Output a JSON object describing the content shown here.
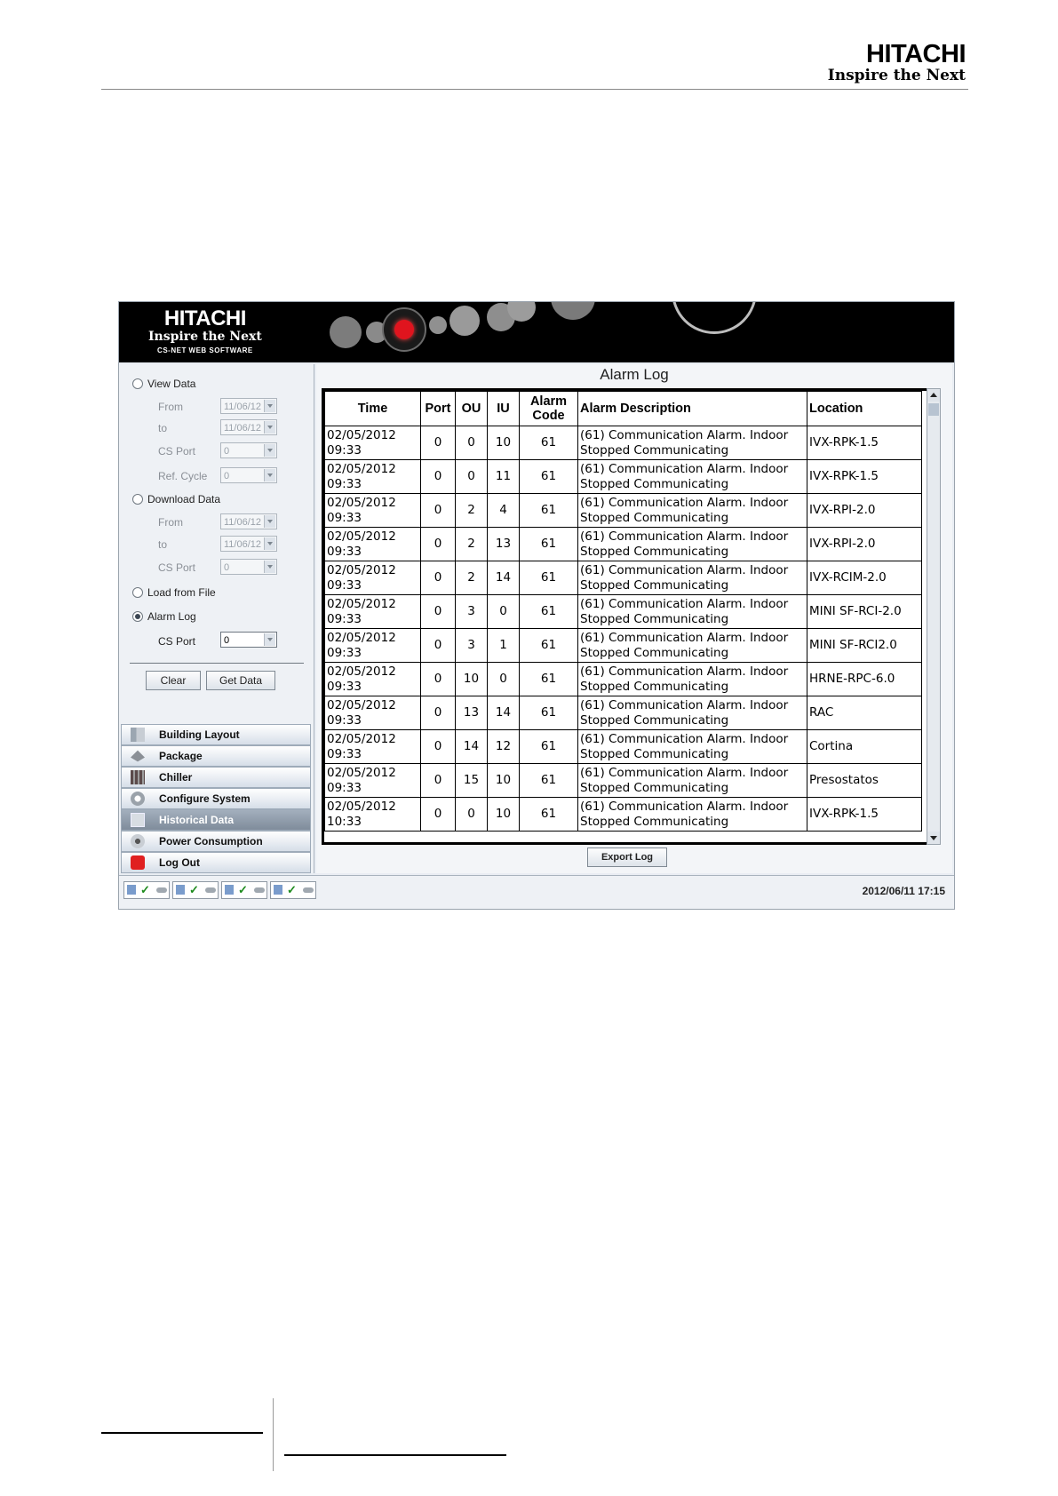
{
  "page_header": {
    "brand": "HITACHI",
    "tagline": "Inspire the Next"
  },
  "app": {
    "banner": {
      "brand": "HITACHI",
      "tagline": "Inspire the Next",
      "subtitle": "CS-NET WEB SOFTWARE"
    },
    "left": {
      "view_data": {
        "label": "View Data",
        "from_label": "From",
        "from_value": "11/06/12",
        "to_label": "to",
        "to_value": "11/06/12",
        "cs_port_label": "CS Port",
        "cs_port_value": "0",
        "ref_cycle_label": "Ref. Cycle",
        "ref_cycle_value": "0"
      },
      "download_data": {
        "label": "Download Data",
        "from_label": "From",
        "from_value": "11/06/12",
        "to_label": "to",
        "to_value": "11/06/12",
        "cs_port_label": "CS Port",
        "cs_port_value": "0"
      },
      "load_from_file": {
        "label": "Load from File"
      },
      "alarm_log": {
        "label": "Alarm Log",
        "cs_port_label": "CS Port",
        "cs_port_value": "0"
      },
      "clear_label": "Clear",
      "get_data_label": "Get Data",
      "nav": [
        {
          "label": "Building Layout",
          "icon": "building-icon"
        },
        {
          "label": "Package",
          "icon": "package-icon"
        },
        {
          "label": "Chiller",
          "icon": "chiller-icon"
        },
        {
          "label": "Configure System",
          "icon": "gear-icon"
        },
        {
          "label": "Historical Data",
          "icon": "historical-data-icon"
        },
        {
          "label": "Power Consumption",
          "icon": "power-consumption-icon"
        },
        {
          "label": "Log Out",
          "icon": "power-icon"
        }
      ]
    },
    "main": {
      "title": "Alarm Log",
      "columns": [
        "Time",
        "Port",
        "OU",
        "IU",
        "Alarm Code",
        "Alarm Description",
        "Location"
      ],
      "rows": [
        {
          "date": "02/05/2012",
          "time": "09:33",
          "port": "0",
          "ou": "0",
          "iu": "10",
          "code": "61",
          "desc1": "(61) Communication Alarm. Indoor",
          "desc2": "Stopped Communicating",
          "location": "IVX-RPK-1.5"
        },
        {
          "date": "02/05/2012",
          "time": "09:33",
          "port": "0",
          "ou": "0",
          "iu": "11",
          "code": "61",
          "desc1": "(61) Communication Alarm. Indoor",
          "desc2": "Stopped Communicating",
          "location": "IVX-RPK-1.5"
        },
        {
          "date": "02/05/2012",
          "time": "09:33",
          "port": "0",
          "ou": "2",
          "iu": "4",
          "code": "61",
          "desc1": "(61) Communication Alarm. Indoor",
          "desc2": "Stopped Communicating",
          "location": "IVX-RPI-2.0"
        },
        {
          "date": "02/05/2012",
          "time": "09:33",
          "port": "0",
          "ou": "2",
          "iu": "13",
          "code": "61",
          "desc1": "(61) Communication Alarm. Indoor",
          "desc2": "Stopped Communicating",
          "location": "IVX-RPI-2.0"
        },
        {
          "date": "02/05/2012",
          "time": "09:33",
          "port": "0",
          "ou": "2",
          "iu": "14",
          "code": "61",
          "desc1": "(61) Communication Alarm. Indoor",
          "desc2": "Stopped Communicating",
          "location": "IVX-RCIM-2.0"
        },
        {
          "date": "02/05/2012",
          "time": "09:33",
          "port": "0",
          "ou": "3",
          "iu": "0",
          "code": "61",
          "desc1": "(61) Communication Alarm. Indoor",
          "desc2": "Stopped Communicating",
          "location": "MINI SF-RCI-2.0"
        },
        {
          "date": "02/05/2012",
          "time": "09:33",
          "port": "0",
          "ou": "3",
          "iu": "1",
          "code": "61",
          "desc1": "(61) Communication Alarm. Indoor",
          "desc2": "Stopped Communicating",
          "location": "MINI SF-RCI2.0"
        },
        {
          "date": "02/05/2012",
          "time": "09:33",
          "port": "0",
          "ou": "10",
          "iu": "0",
          "code": "61",
          "desc1": "(61) Communication Alarm. Indoor",
          "desc2": "Stopped Communicating",
          "location": "HRNE-RPC-6.0"
        },
        {
          "date": "02/05/2012",
          "time": "09:33",
          "port": "0",
          "ou": "13",
          "iu": "14",
          "code": "61",
          "desc1": "(61) Communication Alarm. Indoor",
          "desc2": "Stopped Communicating",
          "location": "RAC"
        },
        {
          "date": "02/05/2012",
          "time": "09:33",
          "port": "0",
          "ou": "14",
          "iu": "12",
          "code": "61",
          "desc1": "(61) Communication Alarm. Indoor",
          "desc2": "Stopped Communicating",
          "location": "Cortina"
        },
        {
          "date": "02/05/2012",
          "time": "09:33",
          "port": "0",
          "ou": "15",
          "iu": "10",
          "code": "61",
          "desc1": "(61) Communication Alarm. Indoor",
          "desc2": "Stopped Communicating",
          "location": "Presostatos"
        },
        {
          "date": "02/05/2012",
          "time": "10:33",
          "port": "0",
          "ou": "0",
          "iu": "10",
          "code": "61",
          "desc1": "(61) Communication Alarm. Indoor",
          "desc2": "Stopped Communicating",
          "location": "IVX-RPK-1.5"
        }
      ],
      "export_label": "Export Log"
    },
    "status": {
      "timestamp": "2012/06/11 17:15"
    }
  },
  "colors": {
    "banner": "#000000",
    "accent_red": "#e0141e",
    "selected_nav": "#8c98a6"
  }
}
